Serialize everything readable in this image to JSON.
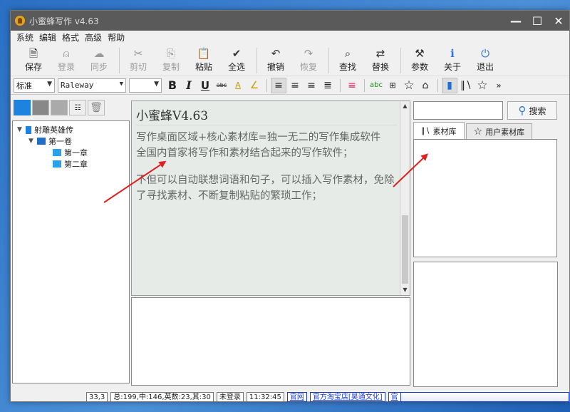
{
  "window": {
    "title": "小蜜蜂写作 v4.63",
    "controls": {
      "minimize": "—",
      "maximize": "☐",
      "close": "✕"
    }
  },
  "menu": [
    "系统",
    "编辑",
    "格式",
    "高级",
    "帮助"
  ],
  "toolbar": [
    {
      "label": "保存",
      "icon": "save-icon",
      "glyph": "🗎",
      "enabled": true
    },
    {
      "label": "登录",
      "icon": "user-icon",
      "glyph": "⍝",
      "enabled": false
    },
    {
      "label": "同步",
      "icon": "sync-icon",
      "glyph": "☁",
      "enabled": false
    },
    {
      "label": "剪切",
      "icon": "cut-icon",
      "glyph": "✂",
      "enabled": false
    },
    {
      "label": "复制",
      "icon": "copy-icon",
      "glyph": "⎘",
      "enabled": false
    },
    {
      "label": "粘贴",
      "icon": "paste-icon",
      "glyph": "📋",
      "enabled": true
    },
    {
      "label": "全选",
      "icon": "select-all-icon",
      "glyph": "✔",
      "enabled": true
    },
    {
      "label": "撤销",
      "icon": "undo-icon",
      "glyph": "↶",
      "enabled": true
    },
    {
      "label": "恢复",
      "icon": "redo-icon",
      "glyph": "↷",
      "enabled": false
    },
    {
      "label": "查找",
      "icon": "find-icon",
      "glyph": "⌕",
      "enabled": true
    },
    {
      "label": "替换",
      "icon": "replace-icon",
      "glyph": "⇄",
      "enabled": true
    },
    {
      "label": "参数",
      "icon": "settings-icon",
      "glyph": "⚒",
      "enabled": true
    },
    {
      "label": "关于",
      "icon": "info-icon",
      "glyph": "ℹ",
      "enabled": true
    },
    {
      "label": "退出",
      "icon": "exit-icon",
      "glyph": "⏻",
      "enabled": true
    }
  ],
  "format": {
    "style_value": "标准",
    "font_value": "Raleway",
    "size_value": ""
  },
  "tree": {
    "book": "射雕英雄传",
    "volume": "第一卷",
    "chapters": [
      "第一章",
      "第二章"
    ]
  },
  "editor": {
    "title": "小蜜蜂V4.63",
    "paragraphs": [
      "写作桌面区域+核心素材库=独一无二的写作集成软件",
      "全国内首家将写作和素材结合起来的写作软件；",
      "不但可以自动联想词语和句子，可以插入写作素材，免除了寻找素材、不断复制粘贴的繁琐工作；"
    ]
  },
  "right": {
    "search_placeholder": "",
    "search_button": "搜索",
    "tabs": [
      "素材库",
      "用户素材库"
    ]
  },
  "status": {
    "position": "33,3",
    "counts": "总:199,中:146,英数:23,其:30",
    "login": "未登录",
    "time": "11:32:45",
    "link_site": "官网",
    "link_shop": "官方淘宝店[昊通文化]",
    "link_extra": "官"
  },
  "colors": {
    "accent": "#2b78d6",
    "annotation": "#e02020",
    "titlebar": "#5a5a5a"
  }
}
